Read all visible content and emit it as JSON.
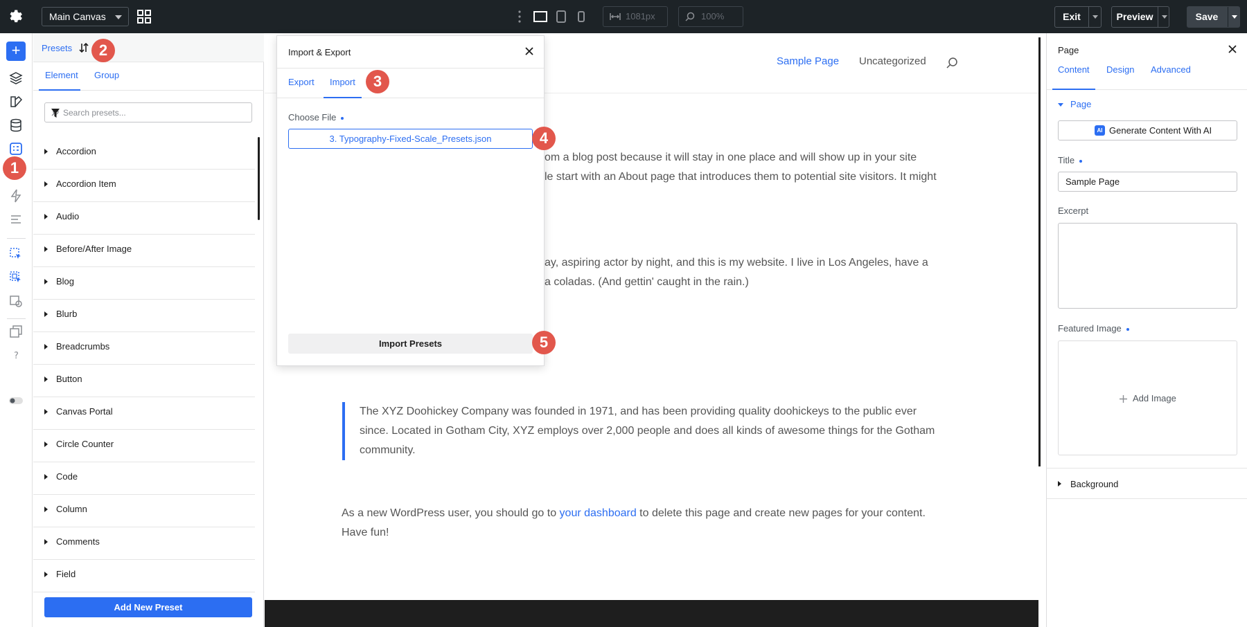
{
  "topbar": {
    "canvas_select": "Main Canvas",
    "width_value": "1081px",
    "zoom_value": "100%",
    "exit_label": "Exit",
    "preview_label": "Preview",
    "save_label": "Save"
  },
  "badges": [
    "1",
    "2",
    "3",
    "4",
    "5"
  ],
  "presets": {
    "title": "Presets",
    "tabs": [
      "Element",
      "Group"
    ],
    "search_placeholder": "Search presets...",
    "items": [
      "Accordion",
      "Accordion Item",
      "Audio",
      "Before/After Image",
      "Blog",
      "Blurb",
      "Breadcrumbs",
      "Button",
      "Canvas Portal",
      "Circle Counter",
      "Code",
      "Column",
      "Comments",
      "Field"
    ],
    "add_button": "Add New Preset"
  },
  "modal": {
    "title": "Import & Export",
    "tabs": [
      "Export",
      "Import"
    ],
    "choose_file_label": "Choose File",
    "file_name": "3. Typography-Fixed-Scale_Presets.json",
    "import_button": "Import Presets"
  },
  "page": {
    "nav": [
      "Sample Page",
      "Uncategorized"
    ],
    "p1_line1": "om a blog post because it will stay in one place and will show up in your site",
    "p1_line2": "le start with an About page that introduces them to potential site visitors. It might",
    "p2_line1": "ay, aspiring actor by night, and this is my website. I live in Los Angeles, have a",
    "p2_line2": "a coladas. (And gettin' caught in the rain.)",
    "quote_line1": "The XYZ Doohickey Company was founded in 1971, and has been providing quality doohickeys to the public ever",
    "quote_line2": "since. Located in Gotham City, XYZ employs over 2,000 people and does all kinds of awesome things for the Gotham",
    "quote_line3": "community.",
    "p3_pre": "As a new WordPress user, you should go to ",
    "p3_link": "your dashboard",
    "p3_post": " to delete this page and create new pages for your content.",
    "p3_line2": "Have fun!"
  },
  "right_panel": {
    "title": "Page",
    "tabs": [
      "Content",
      "Design",
      "Advanced"
    ],
    "section": "Page",
    "ai_button": "Generate Content With AI",
    "ai_icon": "AI",
    "title_label": "Title",
    "title_value": "Sample Page",
    "excerpt_label": "Excerpt",
    "featured_label": "Featured Image",
    "add_image": "Add Image",
    "background": "Background"
  },
  "colors": {
    "accent": "#2c6ef2",
    "badge": "#e2574c",
    "topbar": "#1d2327"
  }
}
